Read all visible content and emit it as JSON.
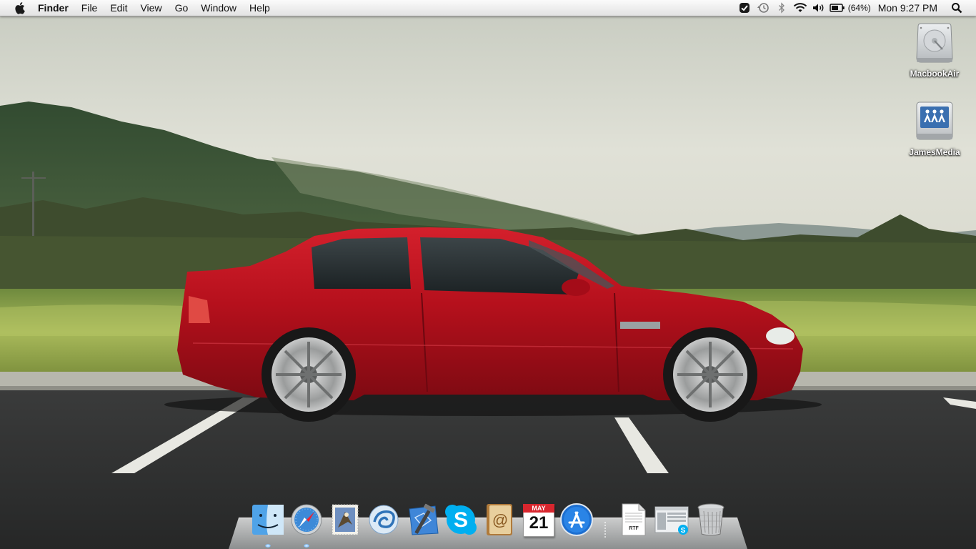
{
  "menubar": {
    "apple_icon": "apple-logo-icon",
    "app_name": "Finder",
    "menus": [
      "File",
      "Edit",
      "View",
      "Go",
      "Window",
      "Help"
    ],
    "status_icons": [
      "task-check-icon",
      "time-machine-icon",
      "bluetooth-icon",
      "wifi-icon",
      "volume-icon",
      "battery-icon"
    ],
    "battery_percent": "(64%)",
    "clock": "Mon 9:27 PM",
    "spotlight_icon": "spotlight-search-icon"
  },
  "desktop": {
    "icons": [
      {
        "label": "MacbookAir",
        "icon": "internal-hard-drive-icon"
      },
      {
        "label": "JamesMedia",
        "icon": "network-share-drive-icon"
      }
    ],
    "wallpaper": "red coupe parked in lot with green hills"
  },
  "dock": {
    "apps": [
      {
        "name": "Finder",
        "icon": "finder-icon",
        "running": true
      },
      {
        "name": "Safari",
        "icon": "safari-icon",
        "running": true
      },
      {
        "name": "Mail",
        "icon": "mail-stamp-icon",
        "running": false
      },
      {
        "name": "Airport Utility",
        "icon": "swirl-app-icon",
        "running": false
      },
      {
        "name": "Xcode",
        "icon": "xcode-icon",
        "running": false
      },
      {
        "name": "Skype",
        "icon": "skype-icon",
        "running": false
      },
      {
        "name": "Address Book",
        "icon": "address-book-icon",
        "running": false
      },
      {
        "name": "iCal",
        "icon": "calendar-icon",
        "running": false,
        "calendar_month": "MAY",
        "calendar_day": "21"
      },
      {
        "name": "App Store",
        "icon": "app-store-icon",
        "running": false
      }
    ],
    "documents": [
      {
        "name": "RTF document",
        "icon": "rtf-document-icon",
        "badge": "RTF"
      },
      {
        "name": "Skype screenshot",
        "icon": "screenshot-document-icon"
      },
      {
        "name": "Trash",
        "icon": "trash-icon"
      }
    ]
  },
  "colors": {
    "menubar_top": "#fbfbfb",
    "menubar_bottom": "#e2e2e2",
    "car_red": "#b8121f",
    "sky": "#dfe0d6",
    "asphalt": "#2d2e2e"
  }
}
